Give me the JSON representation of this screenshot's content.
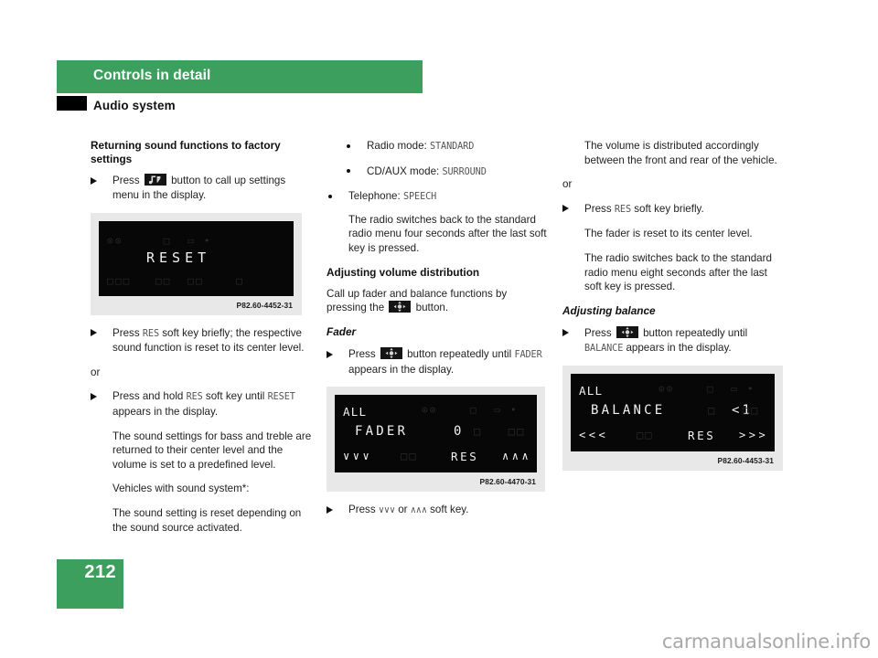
{
  "header": {
    "chapter_title": "Controls in detail",
    "section_title": "Audio system",
    "band_color": "#3d9f5e"
  },
  "page": {
    "number": "212",
    "watermark": "carmanualsonline.info"
  },
  "column1": {
    "heading": "Returning sound functions to factory settings",
    "step1_before": "Press",
    "step1_icon": "sound-settings-button-icon",
    "step1_after": "button to call up settings menu in the display.",
    "figure": {
      "name": "reset-display",
      "caption": "P82.60-4452-31",
      "main_text": "RESET",
      "ghost_row1": "⊙⊙     □  ▭ •",
      "ghost_row3": "□□□   □□  □□    □"
    },
    "step2_before": "Press",
    "step2_key": "RES",
    "step2_after": "soft key briefly; the respective sound function is reset to its center level.",
    "or": "or",
    "step3_before": "Press and hold",
    "step3_key": "RES",
    "step3_mid": "soft key until",
    "step3_key2": "RESET",
    "step3_after": "appears in the display.",
    "para1": "The sound settings for bass and treble are returned to their center level and the volume is set to a predefined level.",
    "para2": "Vehicles with sound system*:",
    "para3": "The sound setting is reset depending on the sound source activated."
  },
  "column2": {
    "bullet1_label": "Radio mode:",
    "bullet1_value": "STANDARD",
    "bullet2_label": "CD/AUX mode:",
    "bullet2_value": "SURROUND",
    "bullet3_label": "Telephone:",
    "bullet3_value": "SPEECH",
    "para1": "The radio switches back to the standard radio menu four seconds after the last soft key is pressed.",
    "heading": "Adjusting volume distribution",
    "para2_before": "Call up fader and balance functions by pressing the",
    "para2_icon": "fader-balance-button-icon",
    "para2_after": "button.",
    "subheading": "Fader",
    "step1_before": "Press",
    "step1_icon": "fader-balance-button-icon",
    "step1_mid": "button repeatedly until",
    "step1_key": "FADER",
    "step1_after": "appears in the display.",
    "figure": {
      "name": "fader-display",
      "caption": "P82.60-4470-31",
      "row1": "ALL",
      "row2_label": "FADER",
      "row2_value": "0",
      "row3_left": "∨∨∨",
      "row3_mid": "RES",
      "row3_right": "∧∧∧",
      "ghost_row1": "⊙⊙    □  ▭ •",
      "ghost_row2": "□   □□",
      "ghost_row3": "□□"
    },
    "step2_before": "Press",
    "step2_key1": "∨∨∨",
    "step2_mid": "or",
    "step2_key2": "∧∧∧",
    "step2_after": "soft key."
  },
  "column3": {
    "para1": "The volume is distributed accordingly between the front and rear of the vehicle.",
    "or": "or",
    "step1_before": "Press",
    "step1_key": "RES",
    "step1_after": "soft key briefly.",
    "para2": "The fader is reset to its center level.",
    "para3": "The radio switches back to the standard radio menu eight seconds after the last soft key is pressed.",
    "subheading": "Adjusting balance",
    "step2_before": "Press",
    "step2_icon": "fader-balance-button-icon",
    "step2_mid": "button repeatedly until",
    "step2_key": "BALANCE",
    "step2_after": "appears in the display.",
    "figure": {
      "name": "balance-display",
      "caption": "P82.60-4453-31",
      "row1": "ALL",
      "row2_label": "BALANCE",
      "row2_value": "<1",
      "row3_left": "<<<",
      "row3_mid": "RES",
      "row3_right": ">>>",
      "ghost_row1": "⊙⊙    □  ▭ •",
      "ghost_row2": "□   □□",
      "ghost_row3": "□□"
    }
  }
}
